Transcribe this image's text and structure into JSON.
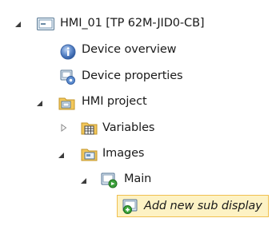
{
  "tree": {
    "root": {
      "label": "HMI_01 [TP 62M-JID0-CB]",
      "icon": "hmi-device-icon"
    },
    "device_overview": {
      "label": "Device overview",
      "icon": "info-icon"
    },
    "device_properties": {
      "label": "Device properties",
      "icon": "device-properties-icon"
    },
    "hmi_project": {
      "label": "HMI project",
      "icon": "hmi-project-folder-icon"
    },
    "variables": {
      "label": "Variables",
      "icon": "variables-folder-icon"
    },
    "images": {
      "label": "Images",
      "icon": "images-folder-icon"
    },
    "main": {
      "label": "Main",
      "icon": "display-screen-icon"
    },
    "add_sub_display": {
      "label": "Add new sub display",
      "icon": "add-display-icon"
    }
  }
}
